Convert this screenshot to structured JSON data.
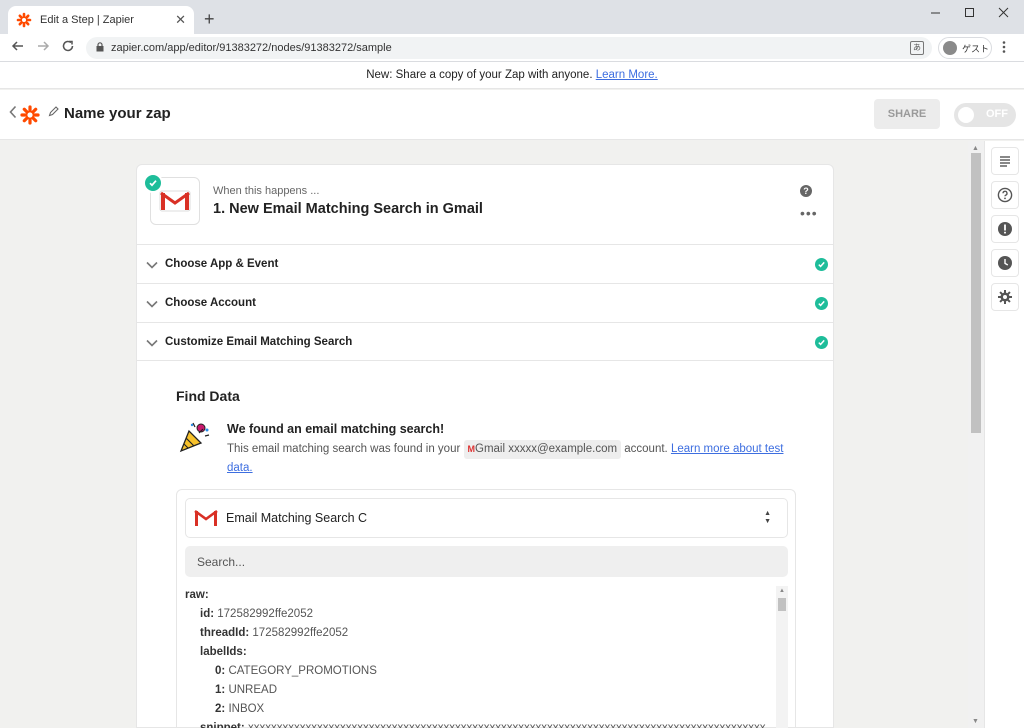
{
  "browser": {
    "tab_title": "Edit a Step | Zapier",
    "tab_close": "✕",
    "new_tab": "+",
    "url": "zapier.com/app/editor/91383272/nodes/91383272/sample",
    "profile_label": "ゲスト",
    "translate_label": "あ"
  },
  "banner": {
    "text": "New: Share a copy of your Zap with anyone.",
    "link": "Learn More."
  },
  "header": {
    "zap_name": "Name your zap",
    "share_label": "SHARE",
    "toggle_label": "OFF",
    "toggle_state": "off"
  },
  "step": {
    "subtitle": "When this happens ...",
    "title": "1. New Email Matching Search in Gmail",
    "help_glyph": "?",
    "more_glyph": "•••",
    "app_icon": "gmail-icon"
  },
  "sections": [
    {
      "label": "Choose App & Event",
      "status": "complete"
    },
    {
      "label": "Choose Account",
      "status": "complete"
    },
    {
      "label": "Customize Email Matching Search",
      "status": "complete"
    }
  ],
  "find_data": {
    "heading": "Find Data",
    "found_title": "We found an email matching search!",
    "found_desc_before": "This email matching search was found in your",
    "account_pill": "Gmail xxxxx@example.com",
    "found_desc_after": "account.",
    "learn_link": "Learn more about test data."
  },
  "sample": {
    "selected": "Email Matching Search C",
    "search_placeholder": "Search...",
    "rows": [
      {
        "indent": 0,
        "key": "raw:",
        "value": ""
      },
      {
        "indent": 1,
        "key": "id:",
        "value": "172582992ffe2052"
      },
      {
        "indent": 1,
        "key": "threadId:",
        "value": "172582992ffe2052"
      },
      {
        "indent": 1,
        "key": "labelIds:",
        "value": ""
      },
      {
        "indent": 2,
        "key": "0:",
        "value": "CATEGORY_PROMOTIONS"
      },
      {
        "indent": 2,
        "key": "1:",
        "value": "UNREAD"
      },
      {
        "indent": 2,
        "key": "2:",
        "value": "INBOX"
      },
      {
        "indent": 1,
        "key": "snippet:",
        "value": "xxxxxxxxxxxxxxxxxxxxxxxxxxxxxxxxxxxxxxxxxxxxxxxxxxxxxxxxxxxxxxxxxxxxxxxxxxxxxxxxxxxxxxxxxx"
      }
    ]
  },
  "colors": {
    "brand_orange": "#ff4a00",
    "success_green": "#1ebd9a",
    "link_blue": "#3d6ee0",
    "gmail_red": "#d93025"
  },
  "rail_icons": [
    "details-icon",
    "help-circle-icon",
    "alert-icon",
    "history-icon",
    "settings-icon"
  ]
}
